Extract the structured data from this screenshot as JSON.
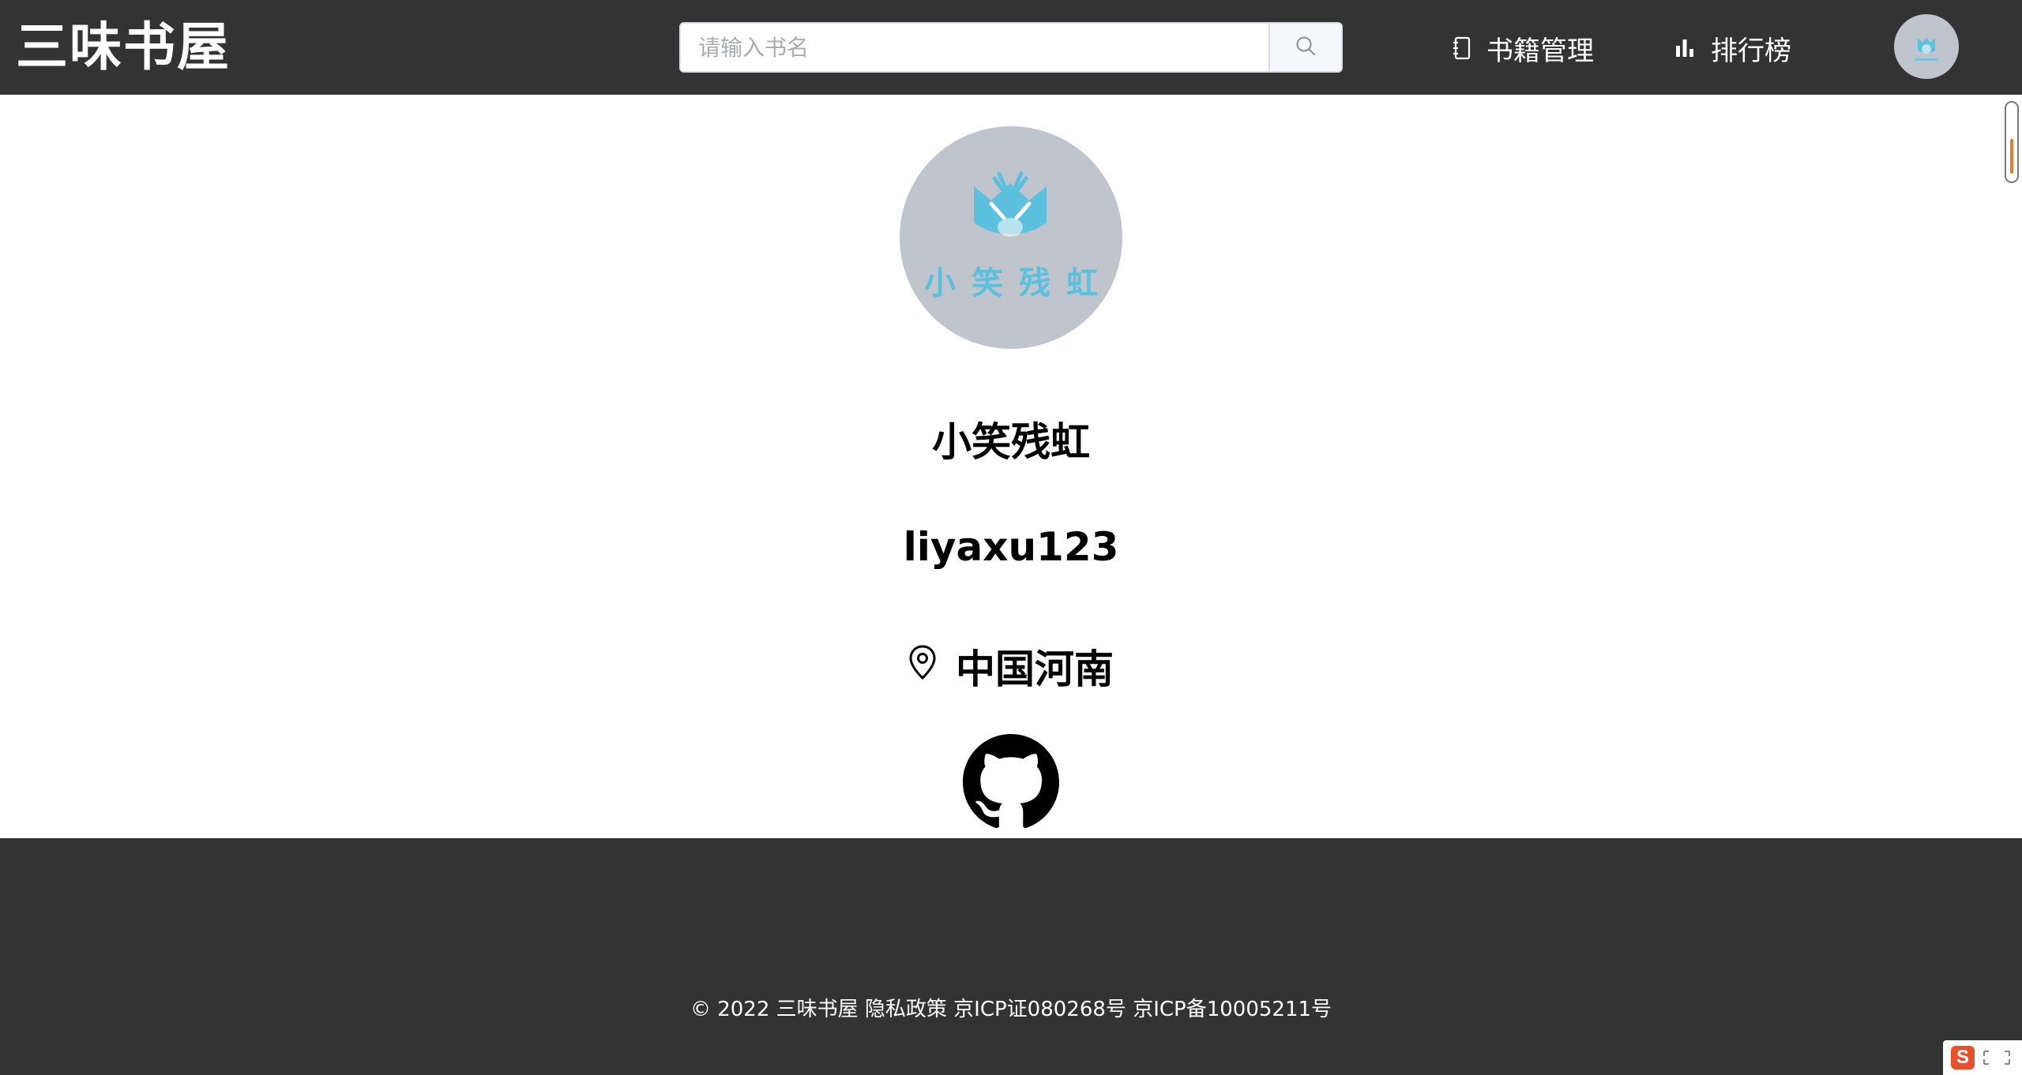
{
  "header": {
    "logo": "三味书屋",
    "search": {
      "placeholder": "请输入书名",
      "value": ""
    },
    "nav": [
      {
        "label": "书籍管理",
        "icon": "notebook-icon"
      },
      {
        "label": "排行榜",
        "icon": "bar-chart-icon"
      }
    ],
    "user_avatar_icon": "user-avatar"
  },
  "profile": {
    "avatar_text": "小笑残虹",
    "nickname": "小笑残虹",
    "username": "liyaxu123",
    "location": "中国河南",
    "location_icon": "location-pin-icon",
    "github_icon": "github-icon"
  },
  "footer": {
    "text": "© 2022 三味书屋 隐私政策 京ICP证080268号 京ICP备10005211号"
  },
  "ime": {
    "badge": "S"
  },
  "colors": {
    "header_bg": "#333333",
    "footer_bg": "#333333",
    "avatar_bg": "#c0c4cc",
    "avatar_accent": "#5bc0de",
    "ime_accent": "#e8512b"
  }
}
